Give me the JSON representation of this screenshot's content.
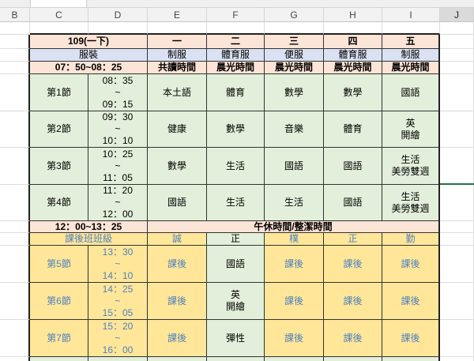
{
  "sheet": {
    "column_headers": [
      "B",
      "C",
      "D",
      "E",
      "F",
      "G",
      "H",
      "I",
      "J"
    ]
  },
  "schedule": {
    "term": "109(一下)",
    "weekdays": [
      "一",
      "二",
      "三",
      "四",
      "五"
    ],
    "dress_code": {
      "label": "服裝",
      "by_day": [
        "制服",
        "體育服",
        "便服",
        "體育服",
        "制服"
      ]
    },
    "morning": {
      "time": "07：50~08：25",
      "by_day": [
        "共讀時間",
        "晨光時間",
        "晨光時間",
        "晨光時間",
        "晨光時間"
      ]
    },
    "morning_periods": [
      {
        "period": "第1節",
        "start": "08：35",
        "to": "~",
        "end": "09：15",
        "by_day": [
          [
            "本土語"
          ],
          [
            "體育"
          ],
          [
            "數學"
          ],
          [
            "數學"
          ],
          [
            "國語"
          ]
        ]
      },
      {
        "period": "第2節",
        "start": "09：30",
        "to": "~",
        "end": "10：10",
        "by_day": [
          [
            "健康"
          ],
          [
            "數學"
          ],
          [
            "音樂"
          ],
          [
            "體育"
          ],
          [
            "英",
            "開繪"
          ]
        ]
      },
      {
        "period": "第3節",
        "start": "10：25",
        "to": "~",
        "end": "11：05",
        "by_day": [
          [
            "數學"
          ],
          [
            "生活"
          ],
          [
            "國語"
          ],
          [
            "國語"
          ],
          [
            "生活",
            "美勞雙週"
          ]
        ]
      },
      {
        "period": "第4節",
        "start": "11：20",
        "to": "~",
        "end": "12：00",
        "by_day": [
          [
            "國語"
          ],
          [
            "生活"
          ],
          [
            "生活"
          ],
          [
            "國語"
          ],
          [
            "生活",
            "美勞雙週"
          ]
        ]
      }
    ],
    "midday": {
      "time": "12：00~13：25",
      "label": "午休時間/整潔時間"
    },
    "after_school_classes": {
      "label": "課後班班級",
      "by_day": [
        "誠",
        "正",
        "樸",
        "正",
        "勤"
      ]
    },
    "afternoon_periods": [
      {
        "period": "第5節",
        "start": "13：30",
        "to": "~",
        "end": "14：10",
        "by_day": [
          [
            "課後"
          ],
          [
            "國語"
          ],
          [
            "課後"
          ],
          [
            "課後"
          ],
          [
            "課後"
          ]
        ]
      },
      {
        "period": "第6節",
        "start": "14：25",
        "to": "~",
        "end": "15：05",
        "by_day": [
          [
            "課後"
          ],
          [
            "英",
            "開繪"
          ],
          [
            "課後"
          ],
          [
            "課後"
          ],
          [
            "課後"
          ]
        ]
      },
      {
        "period": "第7節",
        "start": "15：20",
        "to": "~",
        "end": "16：00",
        "by_day": [
          [
            "課後"
          ],
          [
            "彈性"
          ],
          [
            "課後"
          ],
          [
            "課後"
          ],
          [
            "課後"
          ]
        ]
      }
    ]
  },
  "colors": {
    "header_pink": "#FCE4D6",
    "dress_lavender": "#D9E1F2",
    "class_green": "#E2EFDA",
    "after_school_yellow": "#FFE699",
    "after_school_text_blue": "#4F81BD",
    "selection_green": "#217346"
  }
}
